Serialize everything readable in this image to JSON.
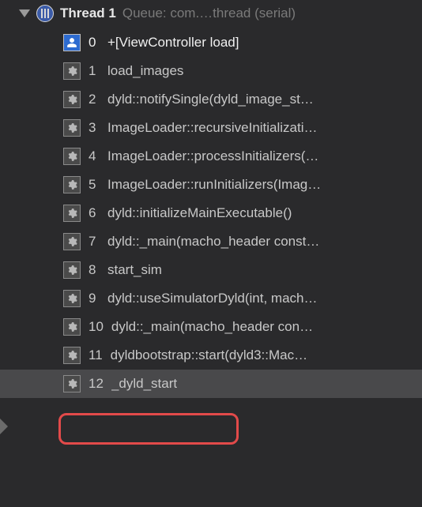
{
  "thread": {
    "title": "Thread 1",
    "queue": "Queue: com.…thread (serial)"
  },
  "frames": [
    {
      "num": "0",
      "label": "+[ViewController load]",
      "kind": "user",
      "current": true,
      "selected": false
    },
    {
      "num": "1",
      "label": "load_images",
      "kind": "system",
      "current": false,
      "selected": false
    },
    {
      "num": "2",
      "label": "dyld::notifySingle(dyld_image_st…",
      "kind": "system",
      "current": false,
      "selected": false
    },
    {
      "num": "3",
      "label": "ImageLoader::recursiveInitializati…",
      "kind": "system",
      "current": false,
      "selected": false
    },
    {
      "num": "4",
      "label": "ImageLoader::processInitializers(…",
      "kind": "system",
      "current": false,
      "selected": false
    },
    {
      "num": "5",
      "label": "ImageLoader::runInitializers(Imag…",
      "kind": "system",
      "current": false,
      "selected": false
    },
    {
      "num": "6",
      "label": "dyld::initializeMainExecutable()",
      "kind": "system",
      "current": false,
      "selected": false
    },
    {
      "num": "7",
      "label": "dyld::_main(macho_header const…",
      "kind": "system",
      "current": false,
      "selected": false
    },
    {
      "num": "8",
      "label": "start_sim",
      "kind": "system",
      "current": false,
      "selected": false
    },
    {
      "num": "9",
      "label": "dyld::useSimulatorDyld(int, mach…",
      "kind": "system",
      "current": false,
      "selected": false
    },
    {
      "num": "10",
      "label": "dyld::_main(macho_header con…",
      "kind": "system",
      "current": false,
      "selected": false
    },
    {
      "num": "11",
      "label": "dyldbootstrap::start(dyld3::Mac…",
      "kind": "system",
      "current": false,
      "selected": false
    },
    {
      "num": "12",
      "label": "_dyld_start",
      "kind": "system",
      "current": false,
      "selected": true
    }
  ],
  "highlight": {
    "color": "#e24a4a"
  }
}
